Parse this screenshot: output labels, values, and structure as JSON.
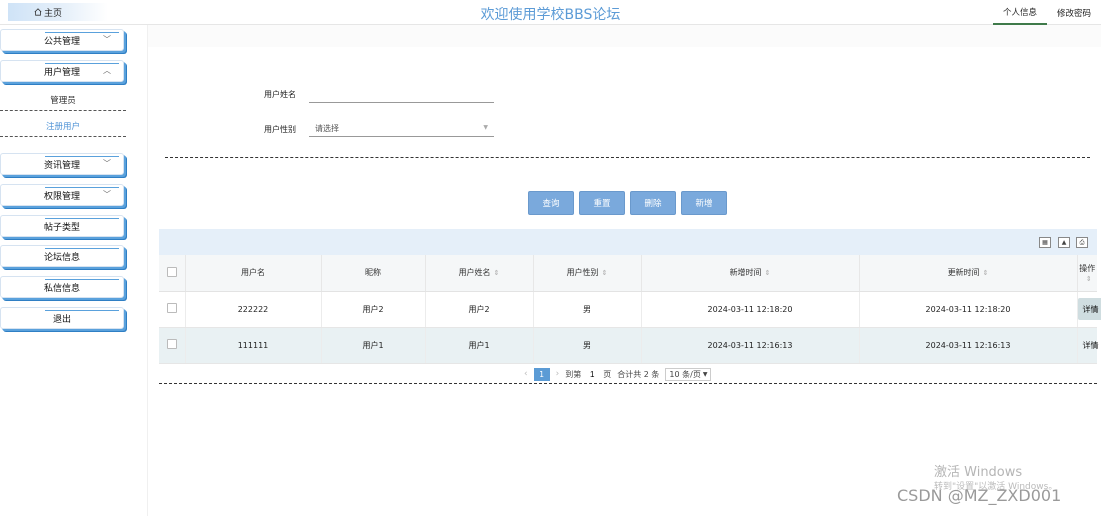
{
  "header": {
    "home_label": "主页",
    "site_title": "欢迎使用学校BBS论坛",
    "nav": [
      {
        "label": "个人信息",
        "active": true
      },
      {
        "label": "修改密码",
        "active": false
      }
    ]
  },
  "sidebar": {
    "items": [
      {
        "label": "公共管理",
        "chevron": "down"
      },
      {
        "label": "用户管理",
        "chevron": "up",
        "expanded": true
      },
      {
        "label": "资讯管理",
        "chevron": "down"
      },
      {
        "label": "权限管理",
        "chevron": "down"
      },
      {
        "label": "帖子类型"
      },
      {
        "label": "论坛信息"
      },
      {
        "label": "私信信息"
      },
      {
        "label": "退出"
      }
    ],
    "sub_items": [
      {
        "label": "管理员",
        "active": false
      },
      {
        "label": "注册用户",
        "active": true
      }
    ]
  },
  "search_form": {
    "name_label": "用户姓名",
    "name_value": "",
    "gender_label": "用户性别",
    "gender_placeholder": "请选择"
  },
  "actions": {
    "query": "查询",
    "reset": "重置",
    "delete": "删除",
    "add": "新增"
  },
  "table": {
    "columns": [
      "用户名",
      "昵称",
      "用户姓名",
      "用户性别",
      "新增时间",
      "更新时间",
      "操作"
    ],
    "rows": [
      {
        "username": "222222",
        "nickname": "用户2",
        "realname": "用户2",
        "gender": "男",
        "created": "2024-03-11 12:18:20",
        "updated": "2024-03-11 12:18:20",
        "action": "详情"
      },
      {
        "username": "111111",
        "nickname": "用户1",
        "realname": "用户1",
        "gender": "男",
        "created": "2024-03-11 12:16:13",
        "updated": "2024-03-11 12:16:13",
        "action": "详情"
      }
    ]
  },
  "pagination": {
    "current_page": "1",
    "goto_label": "到第",
    "goto_value": "1",
    "page_suffix": "页",
    "total_text": "合计共 2 条",
    "page_size": "10 条/页"
  },
  "watermark": {
    "activate_title": "激活 Windows",
    "activate_sub": "转到\"设置\"以激活 Windows。",
    "csdn": "CSDN @MZ_ZXD001"
  },
  "colors": {
    "title": "#5c9bd6",
    "button": "#7aa9dc",
    "active_sub": "#4f93d6",
    "sidebar_shadow": "#2f7fc4"
  }
}
